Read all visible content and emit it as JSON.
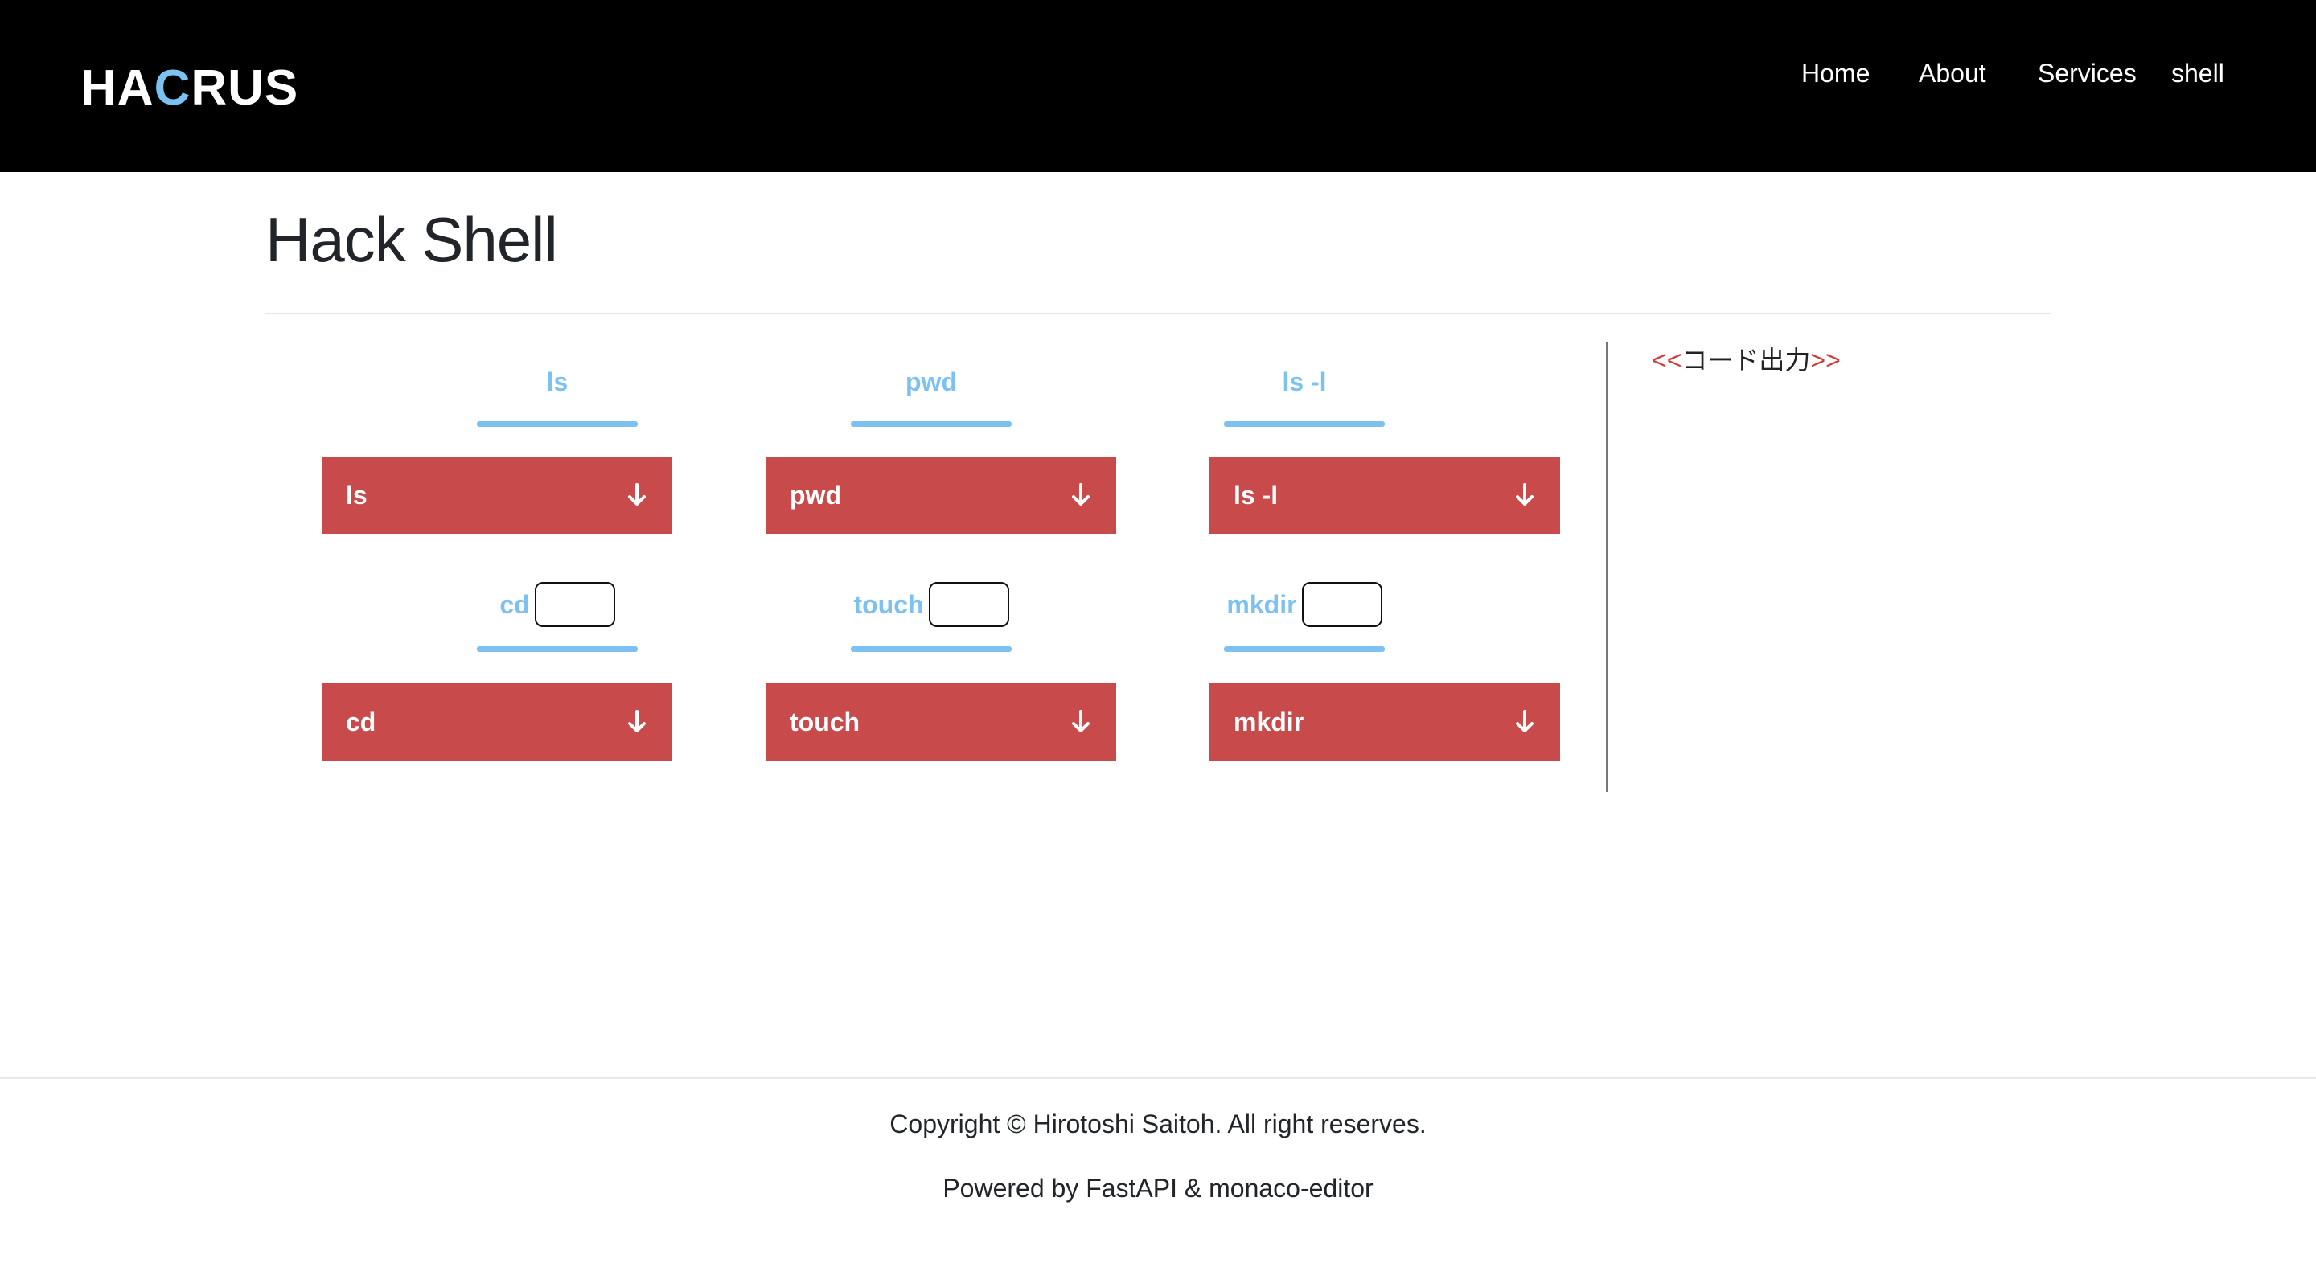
{
  "header": {
    "brand": {
      "part1": "HA",
      "accent": "C",
      "part2": "RUS"
    },
    "nav": [
      "Home",
      "About",
      "Services",
      "shell"
    ]
  },
  "page": {
    "title": "Hack Shell"
  },
  "commands": {
    "ls": {
      "label": "ls",
      "button": "ls"
    },
    "pwd": {
      "label": "pwd",
      "button": "pwd"
    },
    "lsl": {
      "label": "ls -l",
      "button": "ls -l"
    },
    "cd": {
      "label": "cd",
      "button": "cd",
      "value": ""
    },
    "touch": {
      "label": "touch",
      "button": "touch",
      "value": ""
    },
    "mkdir": {
      "label": "mkdir",
      "button": "mkdir",
      "value": ""
    }
  },
  "output": {
    "open": "<<",
    "title": "コード出力",
    "close": ">>"
  },
  "footer": {
    "copyright": "Copyright © Hirotoshi Saitoh. All right reserves.",
    "powered": "Powered by FastAPI & monaco-editor"
  },
  "colors": {
    "navbar": "#000000",
    "accent": "#7cc1f0",
    "button": "#c94a4a",
    "marker": "#d33a3a"
  },
  "icons": {
    "run_button": "arrow-down-icon"
  }
}
